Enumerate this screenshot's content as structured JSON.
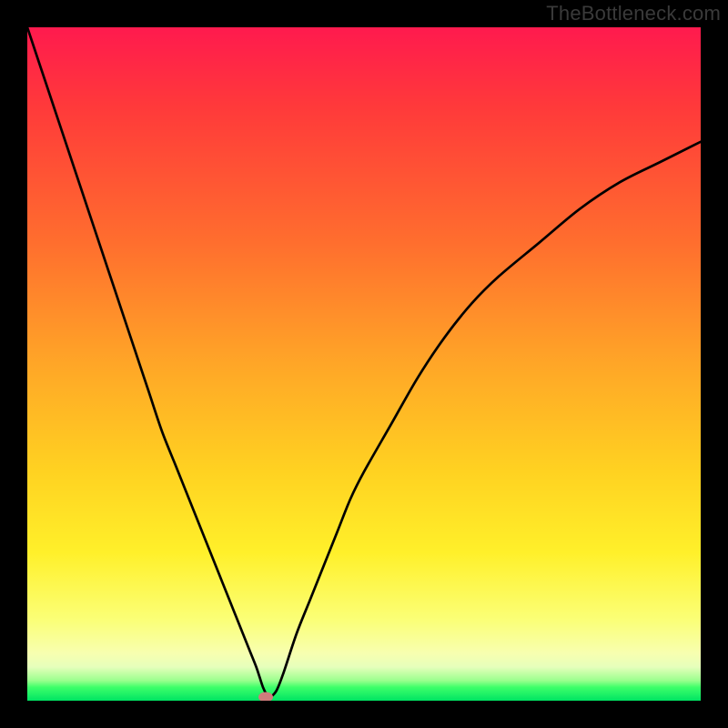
{
  "watermark": "TheBottleneck.com",
  "chart_data": {
    "type": "line",
    "title": "",
    "xlabel": "",
    "ylabel": "",
    "xlim": [
      0,
      100
    ],
    "ylim": [
      0,
      100
    ],
    "grid": false,
    "legend": false,
    "series": [
      {
        "name": "curve",
        "x": [
          0,
          2,
          4,
          6,
          8,
          10,
          12,
          14,
          16,
          18,
          20,
          22,
          24,
          26,
          28,
          30,
          31,
          32,
          33,
          34,
          34.5,
          35,
          35.5,
          36,
          37,
          38,
          40,
          42,
          44,
          46,
          48,
          50,
          54,
          58,
          62,
          66,
          70,
          76,
          82,
          88,
          94,
          100
        ],
        "y": [
          100,
          94,
          88,
          82,
          76,
          70,
          64,
          58,
          52,
          46,
          40,
          35,
          30,
          25,
          20,
          15,
          12.5,
          10,
          7.5,
          5,
          3.5,
          2,
          1,
          0.5,
          1.5,
          4,
          10,
          15,
          20,
          25,
          30,
          34,
          41,
          48,
          54,
          59,
          63,
          68,
          73,
          77,
          80,
          83
        ]
      }
    ],
    "marker": {
      "x": 35.4,
      "y": 0.5
    },
    "color_gradient_stops": [
      {
        "pos": 0,
        "color": "#ff1a4e"
      },
      {
        "pos": 50,
        "color": "#ffa627"
      },
      {
        "pos": 80,
        "color": "#fff02a"
      },
      {
        "pos": 100,
        "color": "#00e463"
      }
    ]
  }
}
